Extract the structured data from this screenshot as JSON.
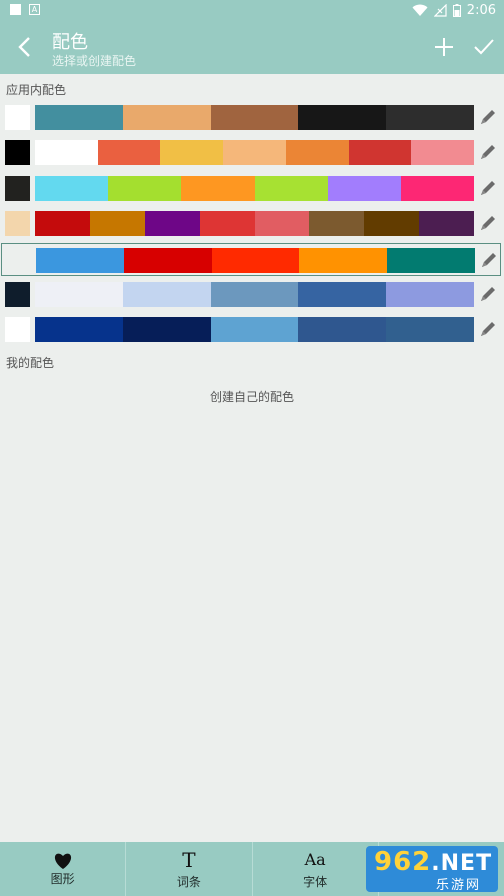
{
  "status": {
    "time": "2:06"
  },
  "header": {
    "title": "配色",
    "subtitle": "选择或创建配色"
  },
  "sections": {
    "builtin_label": "应用内配色",
    "mine_label": "我的配色",
    "empty_hint": "创建自己的配色"
  },
  "palettes": [
    {
      "bg": "#ffffff",
      "colors": [
        "#438f9f",
        "#e9a96b",
        "#a0643f",
        "#171717",
        "#2d2d2d"
      ]
    },
    {
      "bg": "#000000",
      "colors": [
        "#ffffff",
        "#ea6040",
        "#f1bf45",
        "#f5b77a",
        "#eb8535",
        "#d03530",
        "#f28b91"
      ]
    },
    {
      "bg": "#22221f",
      "colors": [
        "#63d9ef",
        "#a4df2f",
        "#fe9721",
        "#a7e132",
        "#a27dfd",
        "#fd2774"
      ]
    },
    {
      "bg": "#f3d6ac",
      "colors": [
        "#c40b0c",
        "#c67700",
        "#6e0687",
        "#de3534",
        "#e15d62",
        "#7c5a2f",
        "#623c00",
        "#4c1e51"
      ]
    },
    {
      "bg": "#ecefed",
      "colors": [
        "#3b97df",
        "#d70000",
        "#ff2a00",
        "#ff9201",
        "#027b70"
      ],
      "selected": true
    },
    {
      "bg": "#0f1d2c",
      "colors": [
        "#eef0f6",
        "#c3d5f0",
        "#6c98be",
        "#3664a2",
        "#8d9ae0"
      ]
    },
    {
      "bg": "#ffffff",
      "colors": [
        "#06338c",
        "#061e58",
        "#5ea3d2",
        "#2f578f",
        "#31608f"
      ]
    }
  ],
  "tabs": [
    {
      "icon": "♥",
      "label": "图形"
    },
    {
      "icon": "T",
      "label": "词条"
    },
    {
      "icon": "Aa",
      "label": "字体"
    },
    {
      "icon": "",
      "label": ""
    }
  ],
  "watermark": {
    "main": "962",
    "net": ".NET",
    "sub": "乐游网"
  }
}
